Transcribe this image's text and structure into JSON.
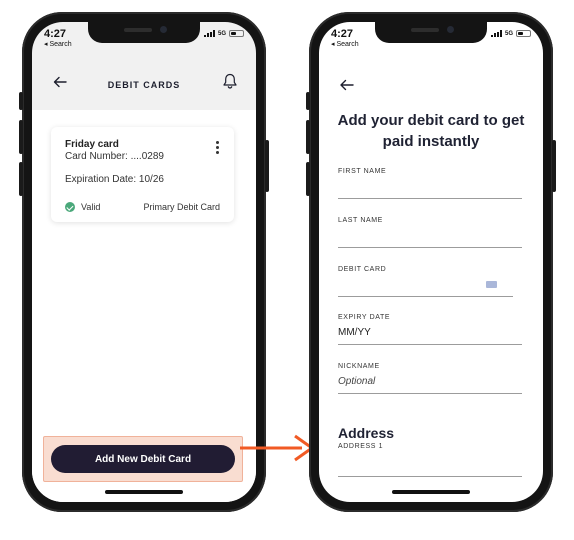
{
  "status_bar": {
    "time": "4:27",
    "back_app": "◂ Search",
    "network": "5G"
  },
  "debit_cards_screen": {
    "title": "DEBIT CARDS",
    "card": {
      "name": "Friday card",
      "number_label": "Card Number:",
      "number_value": "....0289",
      "expiration": "Expiration Date: 10/26",
      "status": "Valid",
      "tag": "Primary Debit Card"
    },
    "add_button_label": "Add New Debit Card"
  },
  "add_card_screen": {
    "headline": "Add your debit card to get paid instantly",
    "fields": {
      "first_name": {
        "label": "FIRST NAME",
        "value": ""
      },
      "last_name": {
        "label": "LAST NAME",
        "value": ""
      },
      "debit_card": {
        "label": "DEBIT CARD",
        "value": ""
      },
      "expiry_date": {
        "label": "EXPIRY DATE",
        "placeholder": "MM/YY"
      },
      "nickname": {
        "label": "NICKNAME",
        "placeholder": "Optional"
      }
    },
    "address_section": {
      "title": "Address",
      "address1_label": "ADDRESS 1",
      "address1_value": ""
    }
  },
  "colors": {
    "button_bg": "#211c33",
    "highlight_fill": "#f9ddd1",
    "arrow": "#f15a24",
    "valid_green": "#4aa87a"
  }
}
